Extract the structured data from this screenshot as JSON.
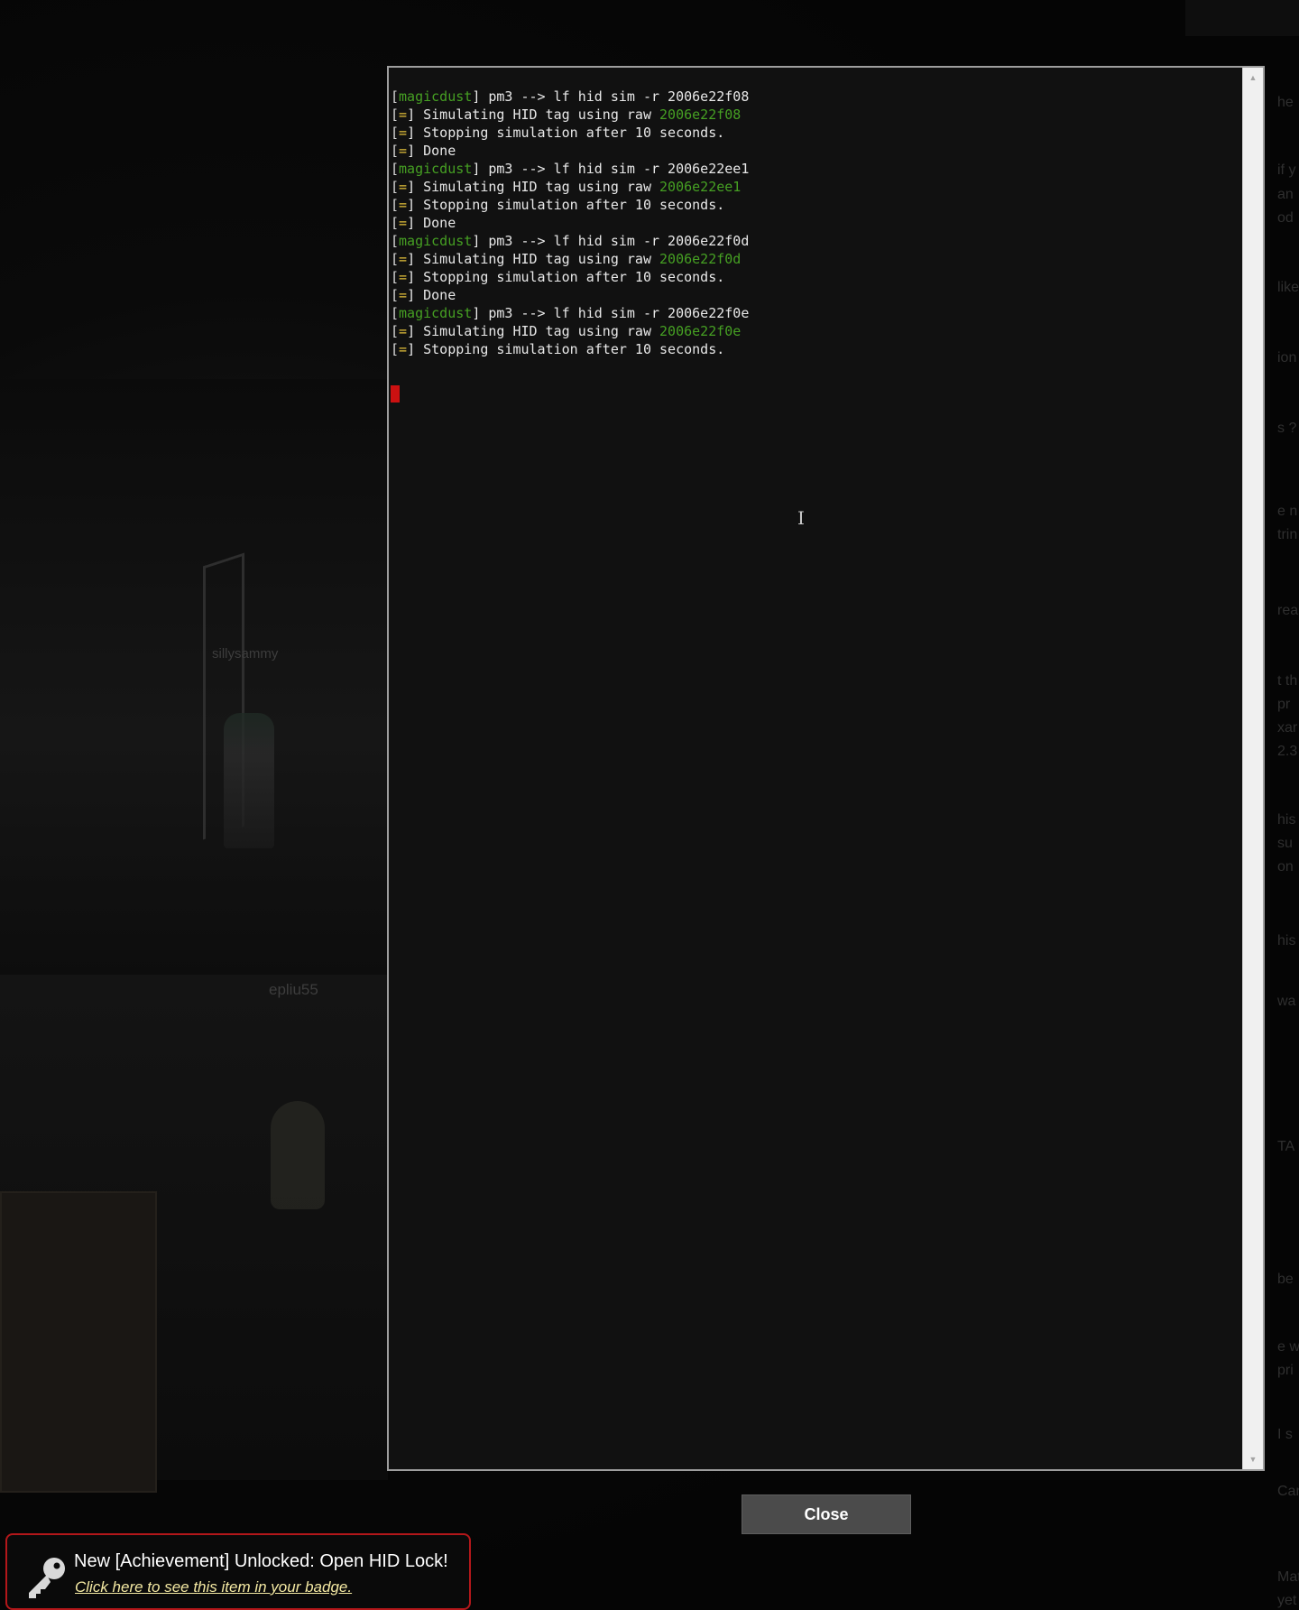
{
  "background": {
    "player_names": [
      "sillysammy",
      "epliu55"
    ],
    "chat_fragments": [
      "he",
      "if y",
      "an",
      "od",
      "like",
      "ion",
      "s ?",
      "e n",
      "trin",
      "rea",
      "t th",
      "pr",
      "xar",
      "2.3",
      "his",
      "su",
      "on",
      "his",
      "wa",
      "TA i",
      "be",
      "e w",
      "pri",
      "I s",
      "Can one",
      "Matches",
      "yet I sti"
    ]
  },
  "terminal": {
    "lines": [
      {
        "segments": [
          {
            "t": "[",
            "c": "gray"
          },
          {
            "t": "magicdust",
            "c": "green"
          },
          {
            "t": "] pm3 --> lf hid sim -r 2006e22f08",
            "c": "white"
          }
        ]
      },
      {
        "segments": [
          {
            "t": "[",
            "c": "gray"
          },
          {
            "t": "=",
            "c": "yellow"
          },
          {
            "t": "] Simulating HID tag using raw ",
            "c": "white"
          },
          {
            "t": "2006e22f08",
            "c": "green"
          }
        ]
      },
      {
        "segments": [
          {
            "t": "[",
            "c": "gray"
          },
          {
            "t": "=",
            "c": "yellow"
          },
          {
            "t": "] Stopping simulation after 10 seconds.",
            "c": "white"
          }
        ]
      },
      {
        "segments": [
          {
            "t": "[",
            "c": "gray"
          },
          {
            "t": "=",
            "c": "yellow"
          },
          {
            "t": "] Done",
            "c": "white"
          }
        ]
      },
      {
        "segments": [
          {
            "t": "[",
            "c": "gray"
          },
          {
            "t": "magicdust",
            "c": "green"
          },
          {
            "t": "] pm3 --> lf hid sim -r 2006e22ee1",
            "c": "white"
          }
        ]
      },
      {
        "segments": [
          {
            "t": "[",
            "c": "gray"
          },
          {
            "t": "=",
            "c": "yellow"
          },
          {
            "t": "] Simulating HID tag using raw ",
            "c": "white"
          },
          {
            "t": "2006e22ee1",
            "c": "green"
          }
        ]
      },
      {
        "segments": [
          {
            "t": "[",
            "c": "gray"
          },
          {
            "t": "=",
            "c": "yellow"
          },
          {
            "t": "] Stopping simulation after 10 seconds.",
            "c": "white"
          }
        ]
      },
      {
        "segments": [
          {
            "t": "[",
            "c": "gray"
          },
          {
            "t": "=",
            "c": "yellow"
          },
          {
            "t": "] Done",
            "c": "white"
          }
        ]
      },
      {
        "segments": [
          {
            "t": "[",
            "c": "gray"
          },
          {
            "t": "magicdust",
            "c": "green"
          },
          {
            "t": "] pm3 --> lf hid sim -r 2006e22f0d",
            "c": "white"
          }
        ]
      },
      {
        "segments": [
          {
            "t": "[",
            "c": "gray"
          },
          {
            "t": "=",
            "c": "yellow"
          },
          {
            "t": "] Simulating HID tag using raw ",
            "c": "white"
          },
          {
            "t": "2006e22f0d",
            "c": "green"
          }
        ]
      },
      {
        "segments": [
          {
            "t": "[",
            "c": "gray"
          },
          {
            "t": "=",
            "c": "yellow"
          },
          {
            "t": "] Stopping simulation after 10 seconds.",
            "c": "white"
          }
        ]
      },
      {
        "segments": [
          {
            "t": "[",
            "c": "gray"
          },
          {
            "t": "=",
            "c": "yellow"
          },
          {
            "t": "] Done",
            "c": "white"
          }
        ]
      },
      {
        "segments": [
          {
            "t": "[",
            "c": "gray"
          },
          {
            "t": "magicdust",
            "c": "green"
          },
          {
            "t": "] pm3 --> lf hid sim -r 2006e22f0e",
            "c": "white"
          }
        ]
      },
      {
        "segments": [
          {
            "t": "[",
            "c": "gray"
          },
          {
            "t": "=",
            "c": "yellow"
          },
          {
            "t": "] Simulating HID tag using raw ",
            "c": "white"
          },
          {
            "t": "2006e22f0e",
            "c": "green"
          }
        ]
      },
      {
        "segments": [
          {
            "t": "[",
            "c": "gray"
          },
          {
            "t": "=",
            "c": "yellow"
          },
          {
            "t": "] Stopping simulation after 10 seconds.",
            "c": "white"
          }
        ]
      }
    ],
    "colors": {
      "green": "#46a023",
      "yellow": "#e3c03a",
      "white": "#e8e8e8",
      "gray": "#d8d8d8",
      "cursor": "#cc1111"
    }
  },
  "close_button": {
    "label": "Close"
  },
  "toast": {
    "icon": "key-icon",
    "title": "New [Achievement] Unlocked: Open HID Lock!",
    "link": "Click here to see this item in your badge.",
    "border_color": "#b3171a"
  }
}
